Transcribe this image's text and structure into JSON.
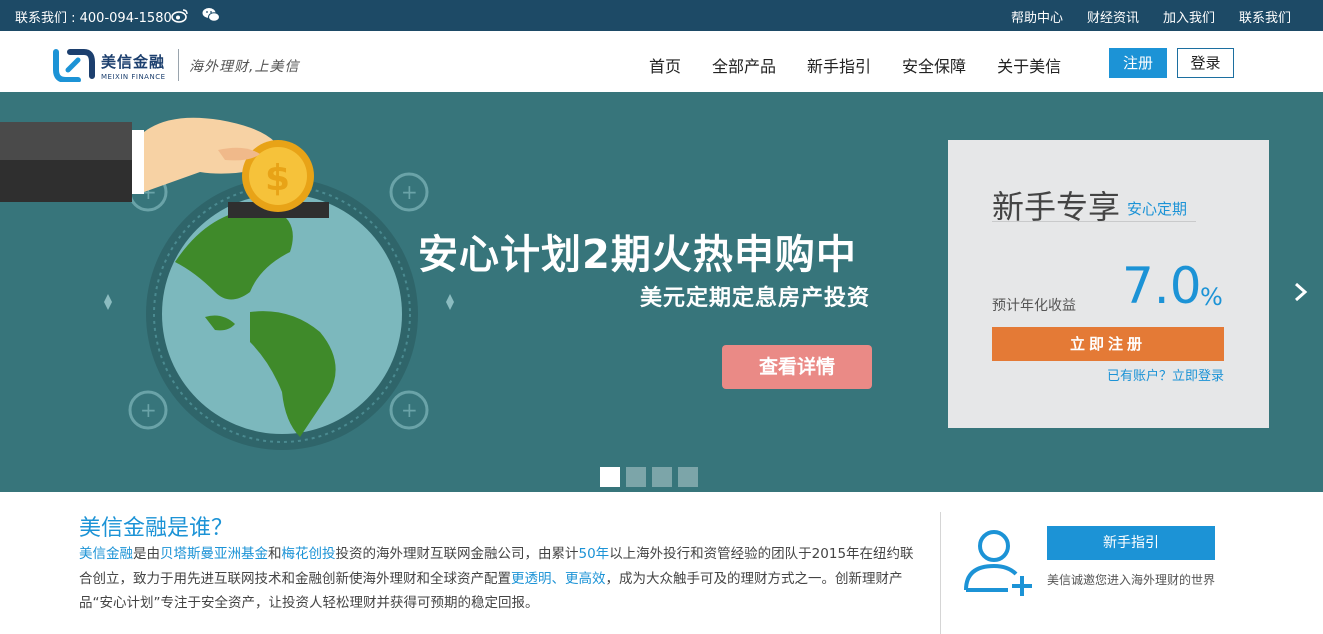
{
  "topbar": {
    "contact": "联系我们 : 400-094-1580",
    "links": [
      "帮助中心",
      "财经资讯",
      "加入我们",
      "联系我们"
    ]
  },
  "header": {
    "logo_cn": "美信金融",
    "logo_en": "MEIXIN FINANCE",
    "slogan": "海外理财,上美信",
    "nav": [
      "首页",
      "全部产品",
      "新手指引",
      "安全保障",
      "关于美信"
    ],
    "register_label": "注册",
    "login_label": "登录"
  },
  "banner": {
    "headline": "安心计划2期火热申购中",
    "subline": "美元定期定息房产投资",
    "details_label": "查看详情",
    "slide_count": 4,
    "active_slide": 1
  },
  "promo_card": {
    "title": "新手专享",
    "subtitle": "安心定期",
    "rate_label": "预计年化收益",
    "rate_value": "7.0",
    "rate_unit": "%",
    "cta_label": "立即注册",
    "login_link": "已有账户？立即登录"
  },
  "about": {
    "title": "美信金融是谁？",
    "p1": "美信金融",
    "p2": "是由",
    "p3": "贝塔斯曼亚洲基金",
    "p4": "和",
    "p5": "梅花创投",
    "p6": "投资的海外理财互联网金融公司，由累计",
    "p7": "50年",
    "p8": "以上海外投行和资管经验的团队于2015年在纽约联合创立，致力于用先进互联网技术和金融创新使海外理财和全球资产配置",
    "p9": "更透明",
    "p10": "、",
    "p11": "更高效",
    "p12": "，成为大众触手可及的理财方式之一。创新理财产品“安心计划”专注于安全资产，让投资人轻松理财并获得可预期的稳定回报。"
  },
  "guide": {
    "button_label": "新手指引",
    "text": "美信诚邀您进入海外理财的世界"
  },
  "colors": {
    "topbar": "#1d4a66",
    "accent": "#1c93d6",
    "banner": "#37757b",
    "cta": "#e47a36",
    "details": "#ea8a86"
  }
}
